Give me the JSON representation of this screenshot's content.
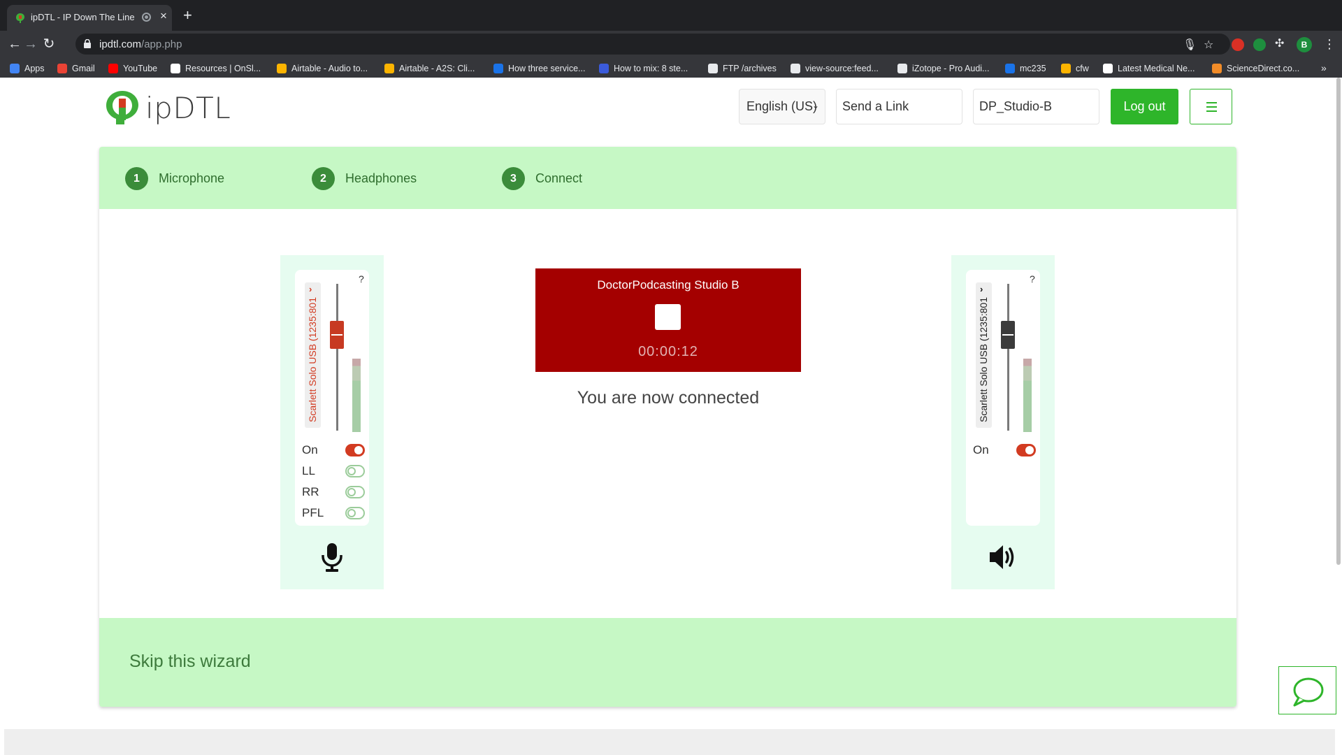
{
  "browser": {
    "tab_title": "ipDTL - IP Down The Line",
    "url_host": "ipdtl.com",
    "url_path": "/app.php",
    "profile_initial": "B",
    "bookmarks": [
      {
        "label": "Apps",
        "color": "#4285f4"
      },
      {
        "label": "Gmail",
        "color": "#ea4335"
      },
      {
        "label": "YouTube",
        "color": "#ff0000"
      },
      {
        "label": "Resources | OnSl...",
        "color": "#ffffff"
      },
      {
        "label": "Airtable - Audio to...",
        "color": "#fcb400"
      },
      {
        "label": "Airtable - A2S: Cli...",
        "color": "#fcb400"
      },
      {
        "label": "How three service...",
        "color": "#1a73e8"
      },
      {
        "label": "How to mix: 8 ste...",
        "color": "#3b5bdb"
      },
      {
        "label": "FTP /archives",
        "color": "#e8eaed"
      },
      {
        "label": "view-source:feed...",
        "color": "#e8eaed"
      },
      {
        "label": "iZotope - Pro Audi...",
        "color": "#e8eaed"
      },
      {
        "label": "mc235",
        "color": "#1a73e8"
      },
      {
        "label": "cfw",
        "color": "#fcb400"
      },
      {
        "label": "Latest Medical Ne...",
        "color": "#ffffff"
      },
      {
        "label": "ScienceDirect.co...",
        "color": "#f28c28"
      }
    ]
  },
  "header": {
    "logo_text": "ipDTL",
    "language": "English (US)",
    "send_link_placeholder": "Send a Link",
    "station_name": "DP_Studio-B",
    "logout_label": "Log out"
  },
  "wizard": {
    "steps": [
      {
        "num": "1",
        "label": "Microphone"
      },
      {
        "num": "2",
        "label": "Headphones"
      },
      {
        "num": "3",
        "label": "Connect"
      }
    ],
    "skip_label": "Skip this wizard"
  },
  "mic_strip": {
    "help": "?",
    "arrow": "›",
    "device": "Scarlett Solo USB (1235:801",
    "toggles": [
      {
        "label": "On",
        "state": "on"
      },
      {
        "label": "LL",
        "state": "off"
      },
      {
        "label": "RR",
        "state": "off"
      },
      {
        "label": "PFL",
        "state": "off"
      }
    ],
    "icon": "microphone-icon",
    "accent": "#d23b21"
  },
  "headphone_strip": {
    "help": "?",
    "arrow": "›",
    "device": "Scarlett Solo USB (1235:801",
    "toggles": [
      {
        "label": "On",
        "state": "on"
      }
    ],
    "icon": "speaker-icon",
    "accent": "#333333"
  },
  "call": {
    "name": "DoctorPodcasting Studio B",
    "timer": "00:00:12",
    "status": "You are now connected",
    "color": "#a40000"
  }
}
